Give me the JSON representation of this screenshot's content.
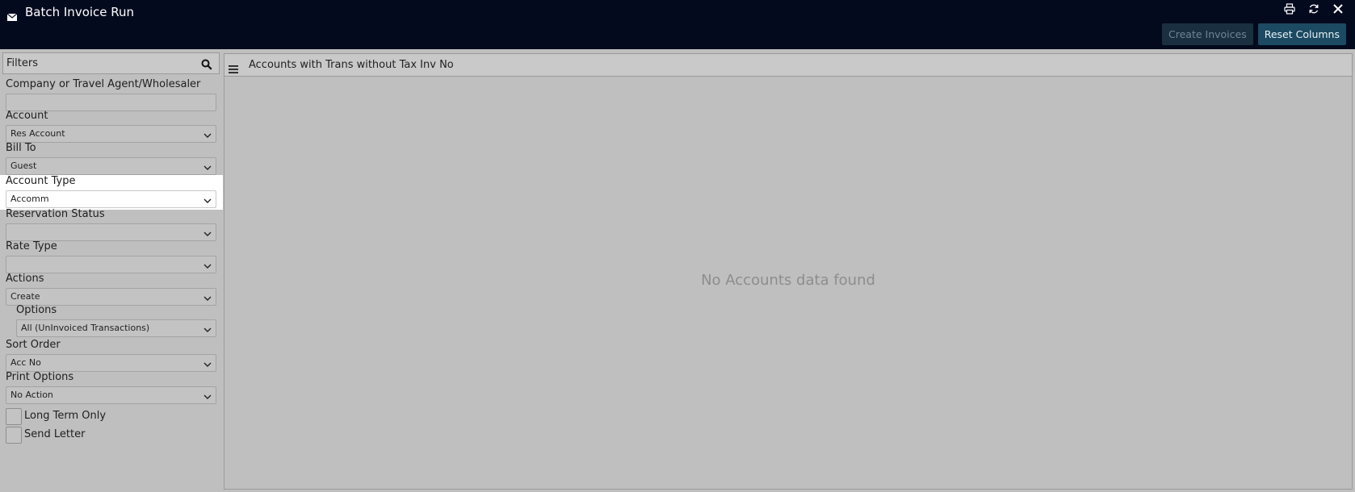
{
  "window": {
    "title": "Batch Invoice Run",
    "icons": [
      "mail-icon",
      "print-icon",
      "refresh-icon",
      "close-icon"
    ]
  },
  "toolbar": {
    "create_invoices_label": "Create Invoices",
    "reset_columns_label": "Reset Columns"
  },
  "filters": {
    "header": "Filters",
    "company_label": "Company or Travel Agent/Wholesaler",
    "company_value": "",
    "account_label": "Account",
    "account_value": "Res Account",
    "bill_to_label": "Bill To",
    "bill_to_value": "Guest",
    "account_type_label": "Account Type",
    "account_type_value": "Accomm",
    "reservation_status_label": "Reservation Status",
    "reservation_status_value": "",
    "rate_type_label": "Rate Type",
    "rate_type_value": "",
    "actions_label": "Actions",
    "actions_value": "Create",
    "options_label": "Options",
    "options_value": "All (UnInvoiced Transactions)",
    "sort_order_label": "Sort Order",
    "sort_order_value": "Acc No",
    "print_options_label": "Print Options",
    "print_options_value": "No Action",
    "long_term_only_label": "Long Term Only",
    "send_letter_label": "Send Letter"
  },
  "grid": {
    "title": "Accounts with Trans without Tax Inv No",
    "empty_message": "No Accounts data found"
  },
  "colors": {
    "topbar": "#030a1e",
    "background": "#bfbfbf",
    "primary_button": "#1b4a62",
    "highlight": "#ffffff"
  }
}
